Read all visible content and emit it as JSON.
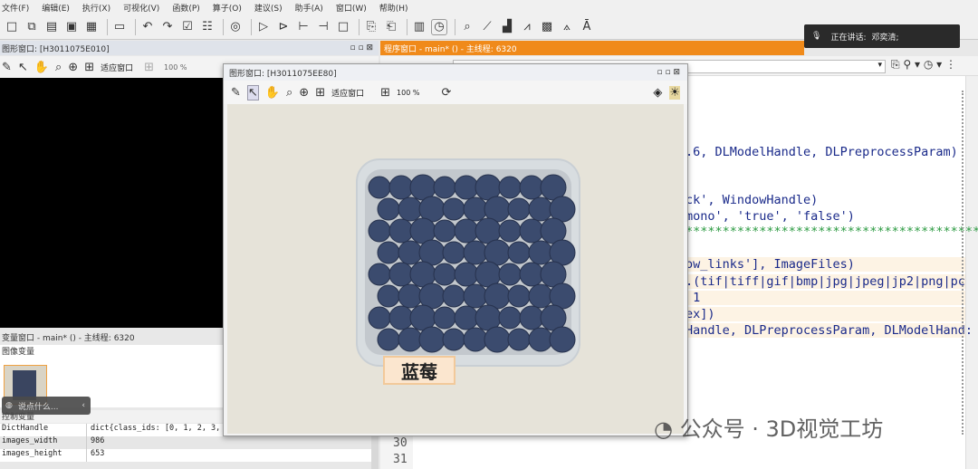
{
  "menu": [
    "文件(F)",
    "编辑(E)",
    "执行(X)",
    "可视化(V)",
    "函数(P)",
    "算子(O)",
    "建议(S)",
    "助手(A)",
    "窗口(W)",
    "帮助(H)"
  ],
  "left_graphics": {
    "title": "图形窗口: [H3011075E010]",
    "fit_label": "适应窗口",
    "zoom": "100 %"
  },
  "popup": {
    "title": "图形窗口: [H3011075EE80]",
    "fit_label": "适应窗口",
    "zoom": "100 %",
    "image_label": "蓝莓"
  },
  "variables": {
    "title": "变量窗口 - main* () - 主线程: 6320",
    "image_vars_label": "图像变量",
    "control_vars_label": "控制变量",
    "rows": [
      {
        "name": "DictHandle",
        "value": "dict{class_ids: [0, 1, 2, 3,"
      },
      {
        "name": "images_width",
        "value": "986"
      },
      {
        "name": "images_height",
        "value": "653"
      }
    ],
    "say_hint": "说点什么..."
  },
  "program": {
    "title": "程序窗口 - main* () - 主线程: 6320",
    "code_lines": [
      ".6, DLModelHandle, DLPreprocessParam)",
      "ck', WindowHandle)",
      "mono', 'true', 'false')",
      "*****************************************",
      "ow_links'], ImageFiles)",
      ".(tif|tiff|gif|bmp|jpg|jpeg|jp2|png|pc",
      " 1",
      "ex])",
      "Handle, DLPreprocessParam, DLModelHand:"
    ],
    "line_numbers": [
      "30",
      "31"
    ]
  },
  "speaking": {
    "label": "正在讲话:",
    "name": "邓奕清;"
  },
  "watermark": "公众号 · 3D视觉工坊",
  "colors": {
    "program_title_bg": "#f08a1a",
    "berry": "#3b4b6e"
  }
}
